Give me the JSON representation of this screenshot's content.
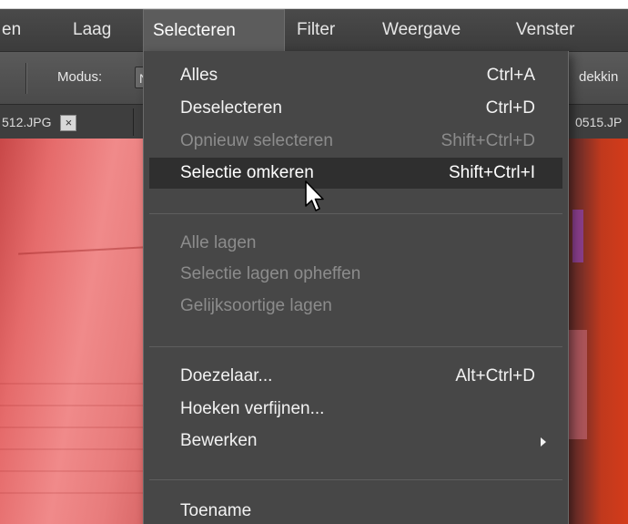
{
  "menubar": {
    "items": [
      "en",
      "Laag",
      "Selecteren",
      "Filter",
      "Weergave",
      "Venster"
    ]
  },
  "options": {
    "mode_label": "Modus:",
    "mode_value": "N",
    "opacity_label": "dekkin"
  },
  "tabs": {
    "left_name": "512.JPG",
    "close_glyph": "×",
    "right_name": "0515.JP"
  },
  "dropdown": {
    "items": [
      {
        "label": "Alles",
        "shortcut": "Ctrl+A",
        "state": "enabled"
      },
      {
        "label": "Deselecteren",
        "shortcut": "Ctrl+D",
        "state": "enabled"
      },
      {
        "label": "Opnieuw selecteren",
        "shortcut": "Shift+Ctrl+D",
        "state": "disabled"
      },
      {
        "label": "Selectie omkeren",
        "shortcut": "Shift+Ctrl+I",
        "state": "highlighted"
      },
      {
        "label": "Alle lagen",
        "shortcut": "",
        "state": "disabled"
      },
      {
        "label": "Selectie lagen opheffen",
        "shortcut": "",
        "state": "disabled"
      },
      {
        "label": "Gelijksoortige lagen",
        "shortcut": "",
        "state": "disabled"
      },
      {
        "label": "Doezelaar...",
        "shortcut": "Alt+Ctrl+D",
        "state": "enabled"
      },
      {
        "label": "Hoeken verfijnen...",
        "shortcut": "",
        "state": "enabled"
      },
      {
        "label": "Bewerken",
        "shortcut": "",
        "state": "enabled",
        "submenu": true
      },
      {
        "label": "Toename",
        "shortcut": "",
        "state": "enabled"
      }
    ]
  },
  "colors": {
    "menubar_bg": "#3c3c3c",
    "dropdown_bg": "#474747",
    "highlight_bg": "#2f2f2f",
    "disabled_text": "#8c8c8c"
  }
}
